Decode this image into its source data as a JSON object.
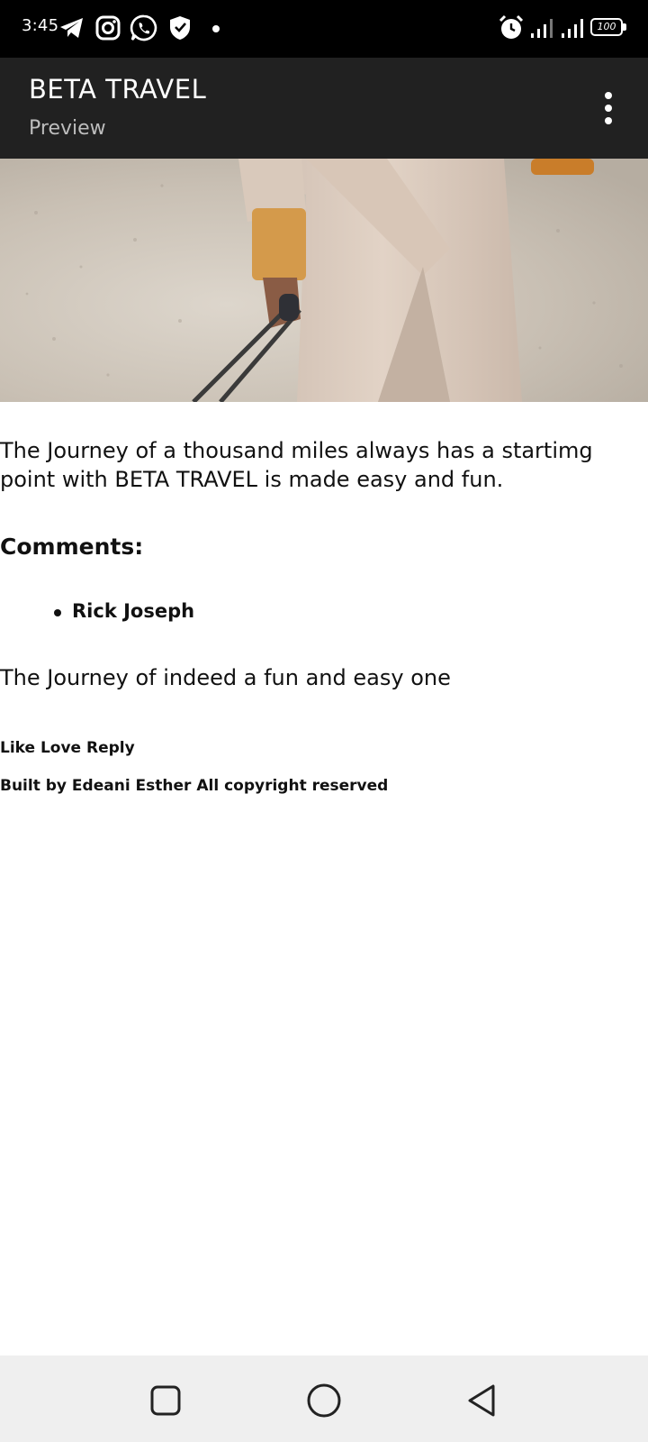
{
  "status_bar": {
    "time": "3:45",
    "left_icons": [
      "telegram-icon",
      "instagram-icon",
      "whatsapp-icon",
      "shield-icon",
      "dot-icon"
    ],
    "right_icons": [
      "alarm-icon",
      "signal-icon",
      "signal-icon",
      "battery-icon"
    ],
    "battery_level": "100"
  },
  "app_bar": {
    "title": "BETA TRAVEL",
    "subtitle": "Preview",
    "menu_icon": "overflow-menu-icon"
  },
  "hero": {
    "icon": "travel-photo"
  },
  "content": {
    "intro": "The Journey of a thousand miles always has a startimg point with BETA TRAVEL is made easy and fun.",
    "comments_heading": "Comments:",
    "comments": [
      {
        "author": "Rick Joseph"
      }
    ],
    "comment_text": "The Journey of indeed a fun and easy one",
    "actions": {
      "like": "Like",
      "love": "Love",
      "reply": "Reply"
    },
    "footer": "Built by Edeani Esther All copyright reserved"
  },
  "nav_bar": {
    "icons": [
      "recents-square-icon",
      "home-circle-icon",
      "back-triangle-icon"
    ]
  },
  "colors": {
    "status_bar": "#000000",
    "app_bar": "#212121",
    "nav_bar": "#efefef",
    "text": "#111111"
  }
}
